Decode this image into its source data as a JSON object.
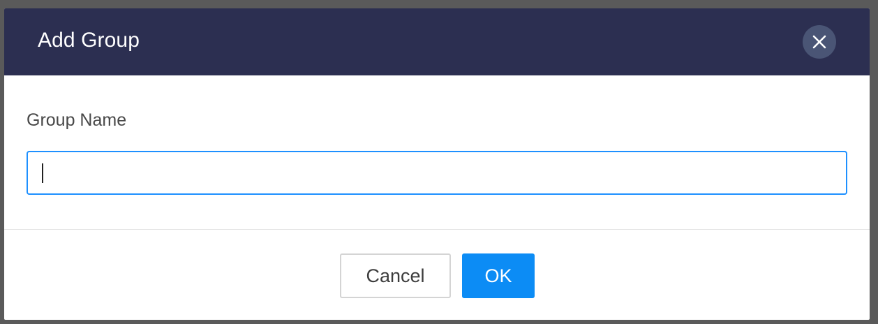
{
  "dialog": {
    "title": "Add Group",
    "close_icon": "close-icon"
  },
  "form": {
    "group_name_label": "Group Name",
    "group_name_value": "",
    "group_name_placeholder": ""
  },
  "footer": {
    "cancel_label": "Cancel",
    "ok_label": "OK"
  },
  "colors": {
    "header_bg": "#2c2f51",
    "primary": "#0c8cf5",
    "input_focus_border": "#1e90ff"
  }
}
